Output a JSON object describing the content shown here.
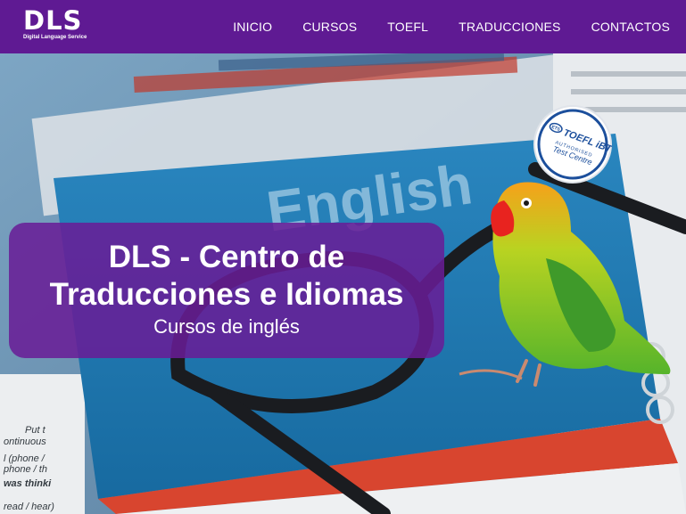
{
  "logo": {
    "main": "DLS",
    "sub": "Digital Language Service"
  },
  "nav": {
    "items": [
      {
        "label": "INICIO"
      },
      {
        "label": "CURSOS"
      },
      {
        "label": "TOEFL"
      },
      {
        "label": "TRADUCCIONES"
      },
      {
        "label": "CONTACTOS"
      }
    ]
  },
  "hero": {
    "title": "DLS - Centro de Traducciones e Idiomas",
    "subtitle": "Cursos de inglés"
  },
  "badge": {
    "ets": "ETS",
    "name": "TOEFL iBT",
    "line1": "AUTHORISED",
    "line2": "Test Centre"
  },
  "background": {
    "book_word": "English",
    "snippets": [
      "Put t",
      "ontinuous",
      "l (phone /",
      "phone / th",
      "was thinki",
      "read / hear)"
    ]
  },
  "colors": {
    "navbar": "#5f1a93",
    "hero_card": "#691c96",
    "book_blue": "#1e76ad",
    "text": "#ffffff"
  }
}
